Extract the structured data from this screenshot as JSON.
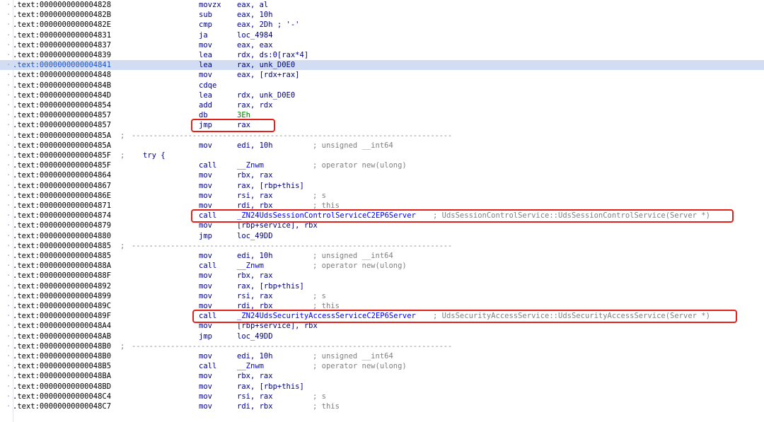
{
  "lines": [
    {
      "addr": ".text:0000000000004828",
      "mn": "movzx",
      "op": "eax, al"
    },
    {
      "addr": ".text:000000000000482B",
      "mn": "sub",
      "op": "eax, 10h"
    },
    {
      "addr": ".text:000000000000482E",
      "mn": "cmp",
      "op": "eax, 2Dh ; '-'"
    },
    {
      "addr": ".text:0000000000004831",
      "mn": "ja",
      "op": "loc_4984"
    },
    {
      "addr": ".text:0000000000004837",
      "mn": "mov",
      "op": "eax, eax"
    },
    {
      "addr": ".text:0000000000004839",
      "mn": "lea",
      "op": "rdx, ds:0[rax*4]"
    },
    {
      "addr": ".text:0000000000004841",
      "mn": "lea",
      "op": "rax, unk_D0E0",
      "sel": true
    },
    {
      "addr": ".text:0000000000004848",
      "mn": "mov",
      "op": "eax, [rdx+rax]"
    },
    {
      "addr": ".text:000000000000484B",
      "mn": "cdqe",
      "op": ""
    },
    {
      "addr": ".text:000000000000484D",
      "mn": "lea",
      "op": "rdx, unk_D0E0"
    },
    {
      "addr": ".text:0000000000004854",
      "mn": "add",
      "op": "rax, rdx"
    },
    {
      "addr": ".text:0000000000004857",
      "mn": "db",
      "op": "3Eh"
    },
    {
      "addr": ".text:0000000000004857",
      "mn": "jmp",
      "op": "rax"
    },
    {
      "addr": ".text:000000000000485A",
      "sep": ";",
      "dashes": "--------------------------------------------------------------------------"
    },
    {
      "addr": ".text:000000000000485A",
      "mn": "mov",
      "op": "edi, 10h",
      "cm": "; unsigned __int64"
    },
    {
      "addr": ".text:000000000000485F",
      "sep": ";",
      "try": "try {"
    },
    {
      "addr": ".text:000000000000485F",
      "mn": "call",
      "op": "__Znwm",
      "sym": true,
      "cm": "; operator new(ulong)"
    },
    {
      "addr": ".text:0000000000004864",
      "mn": "mov",
      "op": "rbx, rax"
    },
    {
      "addr": ".text:0000000000004867",
      "mn": "mov",
      "op": "rax, [rbp+this]"
    },
    {
      "addr": ".text:000000000000486E",
      "mn": "mov",
      "op": "rsi, rax",
      "cm": "; s"
    },
    {
      "addr": ".text:0000000000004871",
      "mn": "mov",
      "op": "rdi, rbx",
      "cm": "; this"
    },
    {
      "addr": ".text:0000000000004874",
      "mn": "call",
      "op": "_ZN24UdsSessionControlServiceC2EP6Server",
      "sym": true,
      "cm": "; UdsSessionControlService::UdsSessionControlService(Server *)"
    },
    {
      "addr": ".text:0000000000004879",
      "mn": "mov",
      "op": "[rbp+service], rbx"
    },
    {
      "addr": ".text:0000000000004880",
      "mn": "jmp",
      "op": "loc_49DD"
    },
    {
      "addr": ".text:0000000000004885",
      "sep": ";",
      "dashes": "--------------------------------------------------------------------------"
    },
    {
      "addr": ".text:0000000000004885",
      "mn": "mov",
      "op": "edi, 10h",
      "cm": "; unsigned __int64"
    },
    {
      "addr": ".text:000000000000488A",
      "mn": "call",
      "op": "__Znwm",
      "sym": true,
      "cm": "; operator new(ulong)"
    },
    {
      "addr": ".text:000000000000488F",
      "mn": "mov",
      "op": "rbx, rax"
    },
    {
      "addr": ".text:0000000000004892",
      "mn": "mov",
      "op": "rax, [rbp+this]"
    },
    {
      "addr": ".text:0000000000004899",
      "mn": "mov",
      "op": "rsi, rax",
      "cm": "; s"
    },
    {
      "addr": ".text:000000000000489C",
      "mn": "mov",
      "op": "rdi, rbx",
      "cm": "; this"
    },
    {
      "addr": ".text:000000000000489F",
      "mn": "call",
      "op": "_ZN24UdsSecurityAccessServiceC2EP6Server",
      "sym": true,
      "cm": "; UdsSecurityAccessService::UdsSecurityAccessService(Server *)"
    },
    {
      "addr": ".text:00000000000048A4",
      "mn": "mov",
      "op": "[rbp+service], rbx"
    },
    {
      "addr": ".text:00000000000048AB",
      "mn": "jmp",
      "op": "loc_49DD"
    },
    {
      "addr": ".text:00000000000048B0",
      "sep": ";",
      "dashes": "--------------------------------------------------------------------------"
    },
    {
      "addr": ".text:00000000000048B0",
      "mn": "mov",
      "op": "edi, 10h",
      "cm": "; unsigned __int64"
    },
    {
      "addr": ".text:00000000000048B5",
      "mn": "call",
      "op": "__Znwm",
      "sym": true,
      "cm": "; operator new(ulong)"
    },
    {
      "addr": ".text:00000000000048BA",
      "mn": "mov",
      "op": "rbx, rax"
    },
    {
      "addr": ".text:00000000000048BD",
      "mn": "mov",
      "op": "rax, [rbp+this]"
    },
    {
      "addr": ".text:00000000000048C4",
      "mn": "mov",
      "op": "rsi, rax",
      "cm": "; s"
    },
    {
      "addr": ".text:00000000000048C7",
      "mn": "mov",
      "op": "rdi, rbx",
      "cm": "; this"
    }
  ],
  "highlights": [
    {
      "line": 12,
      "label": "jmp rax"
    },
    {
      "line": 21,
      "label": "call _ZN24UdsSessionControlServiceC2EP6Server"
    },
    {
      "line": 31,
      "label": "call _ZN24UdsSecurityAccessServiceC2EP6Server"
    }
  ],
  "colors": {
    "highlight_border": "#e0221b",
    "selected_row": "#d2dcf2",
    "instruction_text": "#000080",
    "symbol_text": "#0000ff",
    "comment_text": "#7f7f7f"
  }
}
